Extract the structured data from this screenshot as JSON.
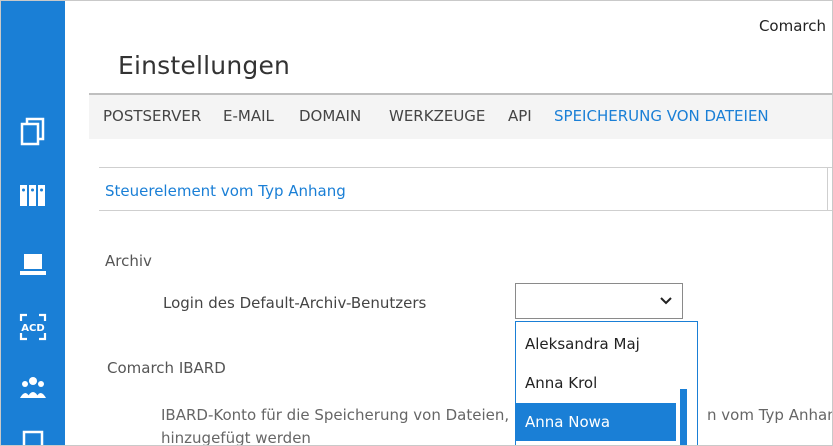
{
  "header": {
    "brand": "Comarch",
    "title": "Einstellungen"
  },
  "tabs": [
    {
      "label": "POSTSERVER"
    },
    {
      "label": "E-MAIL"
    },
    {
      "label": "DOMAIN"
    },
    {
      "label": "WERKZEUGE"
    },
    {
      "label": "API"
    },
    {
      "label": "SPEICHERUNG VON DATEIEN",
      "active": true
    }
  ],
  "section": {
    "header": "Steuerelement vom Typ Anhang"
  },
  "archive": {
    "group_label": "Archiv",
    "field_label": "Login des Default-Archiv-Benutzers",
    "selected_value": "",
    "options": [
      "Aleksandra Maj",
      "Anna Krol",
      "Anna Nowa"
    ],
    "highlighted_option": "Anna Nowa"
  },
  "ibard": {
    "group_label": "Comarch IBARD",
    "description_left": "IBARD-Konto für die Speicherung von Dateien,",
    "description_right": "n vom Typ Anhang",
    "description_line2": "hinzugefügt werden"
  },
  "sidebar": {
    "icons": [
      "documents-icon",
      "binders-icon",
      "laptop-icon",
      "acd-icon",
      "users-icon",
      "document-icon"
    ],
    "acd_text": "ACD"
  },
  "colors": {
    "accent": "#1a7fd6"
  }
}
